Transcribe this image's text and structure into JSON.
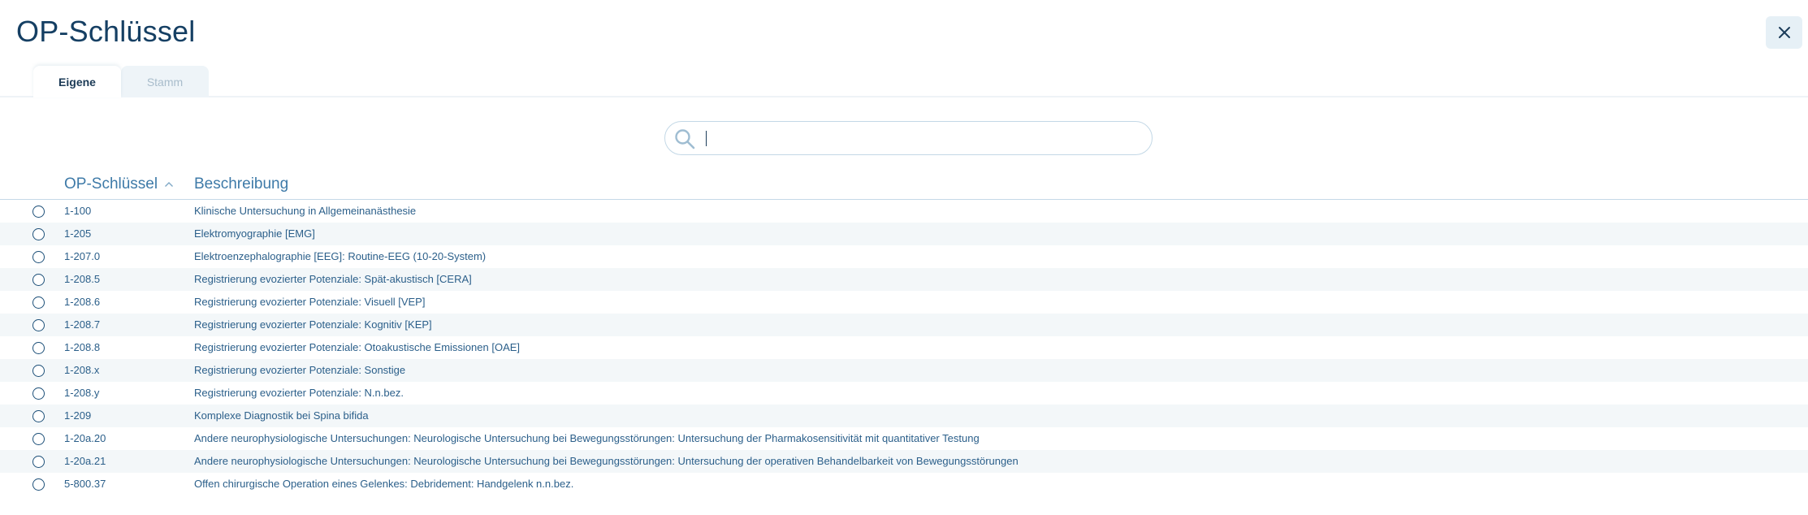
{
  "header": {
    "title": "OP-Schlüssel",
    "close_icon": "close-icon"
  },
  "tabs": [
    {
      "label": "Eigene",
      "active": true
    },
    {
      "label": "Stamm",
      "active": false
    }
  ],
  "search": {
    "value": "",
    "placeholder": "",
    "icon": "search-icon"
  },
  "table": {
    "columns": [
      {
        "label": "OP-Schlüssel",
        "sort": "ascending"
      },
      {
        "label": "Beschreibung"
      }
    ],
    "rows": [
      {
        "key": "1-100",
        "description": "Klinische Untersuchung in Allgemeinanästhesie"
      },
      {
        "key": "1-205",
        "description": "Elektromyographie [EMG]"
      },
      {
        "key": "1-207.0",
        "description": "Elektroenzephalographie [EEG]: Routine-EEG (10-20-System)"
      },
      {
        "key": "1-208.5",
        "description": "Registrierung evozierter Potenziale: Spät-akustisch [CERA]"
      },
      {
        "key": "1-208.6",
        "description": "Registrierung evozierter Potenziale: Visuell [VEP]"
      },
      {
        "key": "1-208.7",
        "description": "Registrierung evozierter Potenziale: Kognitiv [KEP]"
      },
      {
        "key": "1-208.8",
        "description": "Registrierung evozierter Potenziale: Otoakustische Emissionen [OAE]"
      },
      {
        "key": "1-208.x",
        "description": "Registrierung evozierter Potenziale: Sonstige"
      },
      {
        "key": "1-208.y",
        "description": "Registrierung evozierter Potenziale: N.n.bez."
      },
      {
        "key": "1-209",
        "description": "Komplexe Diagnostik bei Spina bifida"
      },
      {
        "key": "1-20a.20",
        "description": "Andere neurophysiologische Untersuchungen: Neurologische Untersuchung bei Bewegungsstörungen: Untersuchung der Pharmakosensitivität mit quantitativer Testung"
      },
      {
        "key": "1-20a.21",
        "description": "Andere neurophysiologische Untersuchungen: Neurologische Untersuchung bei Bewegungsstörungen: Untersuchung der operativen Behandelbarkeit von Bewegungsstörungen"
      },
      {
        "key": "5-800.37",
        "description": "Offen chirurgische Operation eines Gelenkes: Debridement: Handgelenk n.n.bez."
      }
    ]
  },
  "colors": {
    "title": "#153f63",
    "header_text": "#3e7aa8",
    "row_text": "#2b5f8a",
    "row_alt_bg": "#f3f7f9",
    "close_bg": "#e6f0f6",
    "search_border": "#c3d8e6"
  }
}
